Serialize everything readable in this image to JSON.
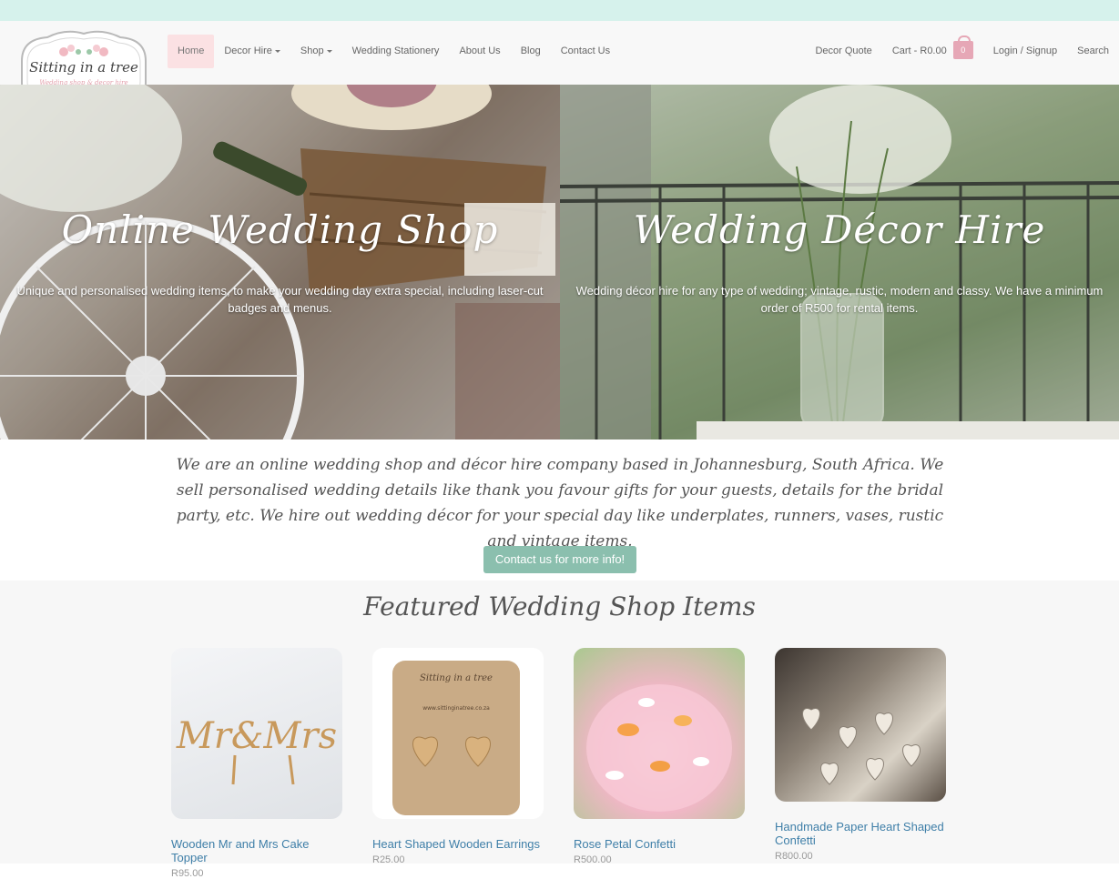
{
  "header": {
    "logo": {
      "title": "Sitting in a tree",
      "tagline": "Wedding shop & decor hire"
    },
    "nav_left": [
      {
        "label": "Home",
        "active": true,
        "dropdown": false
      },
      {
        "label": "Decor Hire",
        "active": false,
        "dropdown": true
      },
      {
        "label": "Shop",
        "active": false,
        "dropdown": true
      },
      {
        "label": "Wedding Stationery",
        "active": false,
        "dropdown": false
      },
      {
        "label": "About Us",
        "active": false,
        "dropdown": false
      },
      {
        "label": "Blog",
        "active": false,
        "dropdown": false
      },
      {
        "label": "Contact Us",
        "active": false,
        "dropdown": false
      }
    ],
    "nav_right": {
      "decor_quote": "Decor Quote",
      "cart_label": "Cart - R0.00",
      "cart_count": "0",
      "login": "Login / Signup",
      "search": "Search"
    }
  },
  "hero": {
    "left": {
      "title": "Online Wedding Shop",
      "text": "Unique and personalised wedding items, to make your wedding day extra special, including laser-cut badges and menus."
    },
    "right": {
      "title": "Wedding Décor Hire",
      "text": "Wedding décor hire for any type of wedding; vintage, rustic, modern and classy. We have a minimum order of R500 for rental items."
    }
  },
  "intro": {
    "text": "We are an online wedding shop and décor hire company based in Johannesburg, South Africa. We sell personalised wedding details like thank you favour gifts for your guests, details for the bridal party, etc. We hire out wedding décor for your special day like underplates, runners, vases, rustic and vintage items.",
    "button": "Contact us for more info!"
  },
  "featured": {
    "title": "Featured Wedding Shop Items",
    "items": [
      {
        "name": "Wooden Mr and Mrs Cake Topper",
        "price": "R95.00"
      },
      {
        "name": "Heart Shaped Wooden Earrings",
        "price": "R25.00"
      },
      {
        "name": "Rose Petal Confetti",
        "price": "R500.00"
      },
      {
        "name": "Handmade Paper Heart Shaped Confetti",
        "price": "R800.00"
      }
    ]
  },
  "colors": {
    "accent": "#8bbfae",
    "top_strip": "#d6f2ec",
    "active_nav": "#fbe1e3",
    "cart_bag": "#e6a7b6",
    "link": "#3f7fa8"
  }
}
